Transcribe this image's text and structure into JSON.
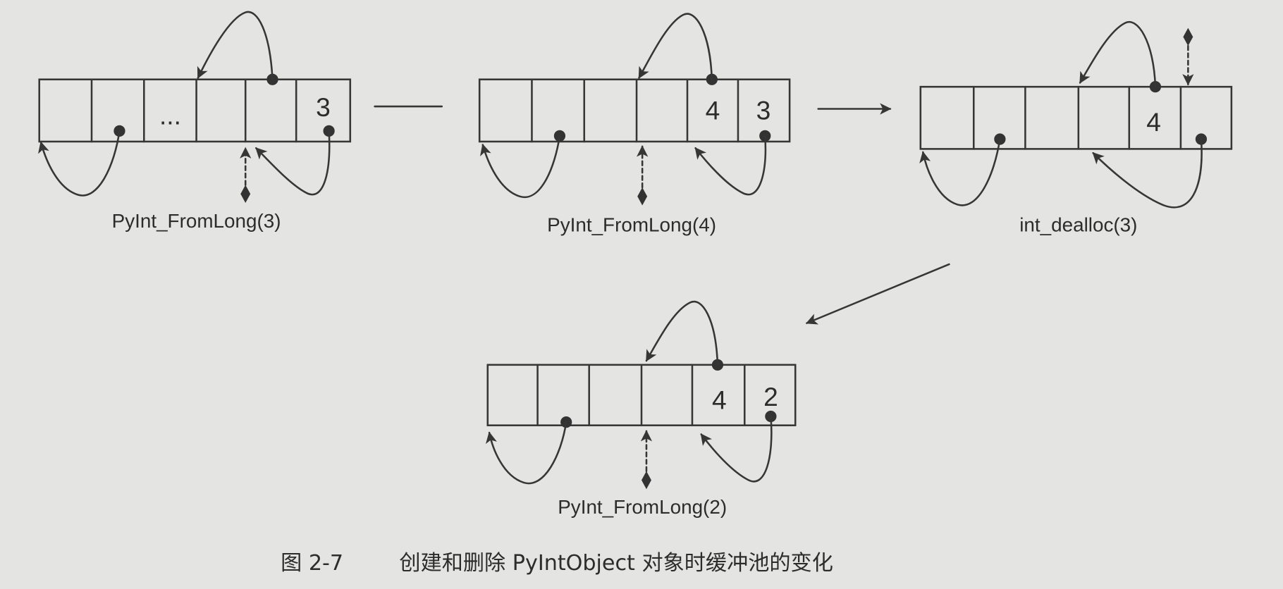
{
  "figure": {
    "number": "图 2-7",
    "caption": "创建和删除 PyIntObject 对象时缓冲池的变化"
  },
  "diagrams": [
    {
      "label": "PyInt_FromLong(3)",
      "cells": [
        null,
        null,
        "...",
        null,
        null,
        "3"
      ]
    },
    {
      "label": "PyInt_FromLong(4)",
      "cells": [
        null,
        null,
        null,
        null,
        "4",
        "3"
      ]
    },
    {
      "label": "int_dealloc(3)",
      "cells": [
        null,
        null,
        null,
        null,
        "4",
        null
      ]
    },
    {
      "label": "PyInt_FromLong(2)",
      "cells": [
        null,
        null,
        null,
        null,
        "4",
        "2"
      ]
    }
  ],
  "colors": {
    "background": "#e4e4e2",
    "ink": "#363636"
  }
}
